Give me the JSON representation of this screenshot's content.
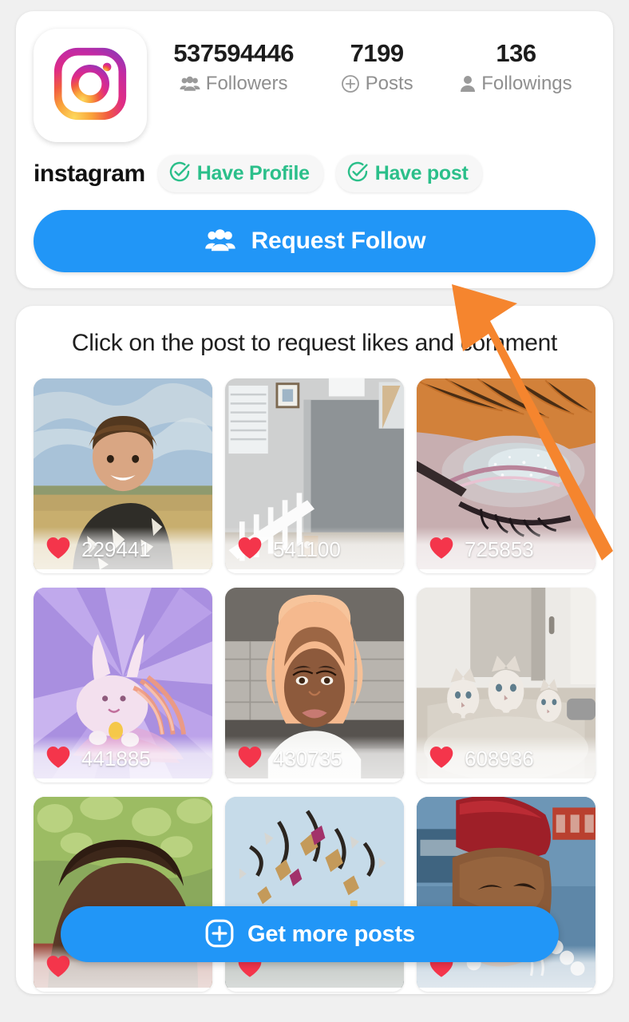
{
  "profile": {
    "avatar_icon": "instagram-logo-icon",
    "name": "instagram",
    "stats": [
      {
        "value": "537594446",
        "label": "Followers",
        "icon": "group-people-icon"
      },
      {
        "value": "7199",
        "label": "Posts",
        "icon": "circle-plus-icon"
      },
      {
        "value": "136",
        "label": "Followings",
        "icon": "person-icon"
      }
    ],
    "badges": [
      {
        "label": "Have Profile",
        "icon": "check-circle-icon"
      },
      {
        "label": "Have post",
        "icon": "check-circle-icon"
      }
    ],
    "request_follow_button": {
      "label": "Request Follow",
      "icon": "group-people-icon"
    }
  },
  "posts_section": {
    "hint": "Click on the post to request likes and comment",
    "get_more_button": {
      "label": "Get more posts",
      "icon": "circle-plus-icon"
    },
    "posts": [
      {
        "likes": "229441",
        "like_icon": "heart-icon",
        "alt": "young-man-in-field"
      },
      {
        "likes": "541100",
        "like_icon": "heart-icon",
        "alt": "interior-stairway"
      },
      {
        "likes": "725853",
        "like_icon": "heart-icon",
        "alt": "glitter-eye-makeup"
      },
      {
        "likes": "441885",
        "like_icon": "heart-icon",
        "alt": "purple-fantasy-artwork"
      },
      {
        "likes": "430735",
        "like_icon": "heart-icon",
        "alt": "woman-peach-bob-wig"
      },
      {
        "likes": "608936",
        "like_icon": "heart-icon",
        "alt": "three-kittens-on-carpet"
      },
      {
        "likes": "",
        "like_icon": "heart-icon",
        "alt": "face-closeup-with-greenery"
      },
      {
        "likes": "",
        "like_icon": "heart-icon",
        "alt": "confetti-streamers-sky"
      },
      {
        "likes": "",
        "like_icon": "heart-icon",
        "alt": "smiling-man-red-cap"
      }
    ]
  },
  "annotation": {
    "arrow_icon": "orange-arrow-up-left-icon",
    "arrow_color": "#f5852e"
  },
  "colors": {
    "accent_blue": "#2196f7",
    "badge_green": "#2bbf8a",
    "heart_red": "#f4354b",
    "page_background": "#f0f0f0",
    "card_background": "#ffffff"
  }
}
